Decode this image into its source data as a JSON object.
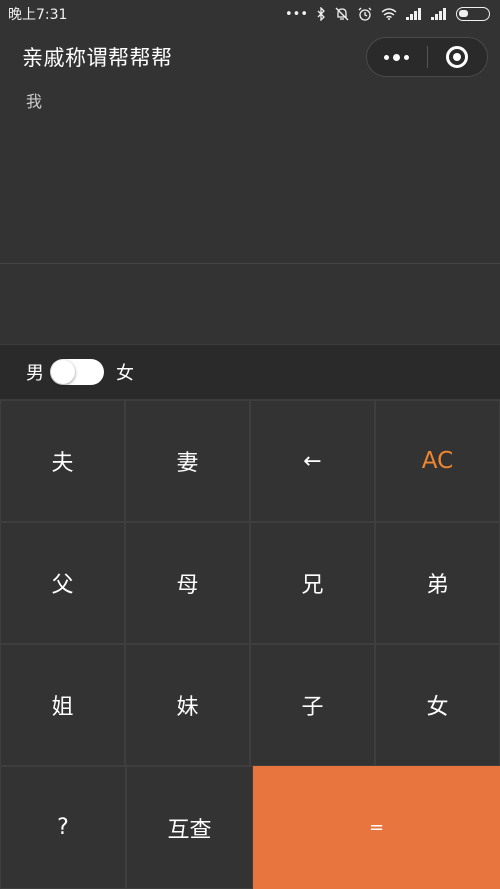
{
  "status_bar": {
    "time": "晚上7:31",
    "icons": [
      "more-dots-icon",
      "bluetooth-icon",
      "mute-icon",
      "alarm-icon",
      "wifi-icon",
      "signal-icon",
      "signal-icon",
      "battery-icon"
    ]
  },
  "header": {
    "title": "亲戚称谓帮帮帮"
  },
  "display": {
    "input": "我",
    "result": ""
  },
  "gender": {
    "male_label": "男",
    "female_label": "女"
  },
  "keypad": {
    "row1": [
      "夫",
      "妻",
      "←",
      "AC"
    ],
    "row2": [
      "父",
      "母",
      "兄",
      "弟"
    ],
    "row3": [
      "姐",
      "妹",
      "子",
      "女"
    ],
    "row4": [
      "?",
      "互查",
      "="
    ]
  },
  "colors": {
    "accent_orange": "#e8743e",
    "ac_orange": "#f0862f",
    "background": "#333333"
  }
}
